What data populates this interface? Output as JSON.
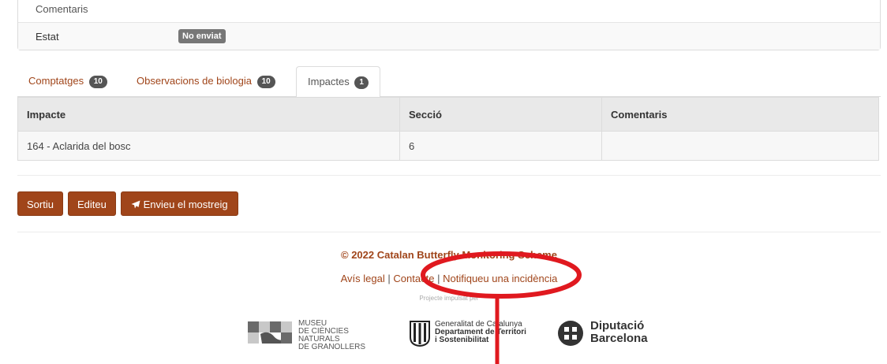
{
  "details": {
    "rows": [
      {
        "label": "Comentaris"
      },
      {
        "label": "Estat",
        "badge": "No enviat"
      }
    ]
  },
  "tabs": [
    {
      "label": "Comptatges",
      "count": "10",
      "active": false
    },
    {
      "label": "Observacions de biologia",
      "count": "10",
      "active": false
    },
    {
      "label": "Impactes",
      "count": "1",
      "active": true
    }
  ],
  "table": {
    "headers": [
      "Impacte",
      "Secció",
      "Comentaris"
    ],
    "rows": [
      [
        "164 - Aclarida del bosc",
        "6",
        ""
      ]
    ]
  },
  "actions": {
    "exit": "Sortiu",
    "edit": "Editeu",
    "send_icon": "paper-plane-icon",
    "send": "Envieu el mostreig"
  },
  "footer": {
    "copyright": "© 2022 Catalan Butterfly Monitoring Scheme",
    "links": [
      "Avís legal",
      "Contacte",
      "Notifiqueu una incidència"
    ],
    "separator": "|",
    "projecte": "Projecte impulsat per"
  },
  "logos": {
    "museu": [
      "MUSEU",
      "DE CIÈNCIES NATURALS",
      "DE GRANOLLERS"
    ],
    "generalitat": [
      "Generalitat de Catalunya",
      "Departament de Territori",
      "i Sostenibilitat"
    ],
    "diputacio": [
      "Diputació",
      "Barcelona"
    ]
  },
  "colors": {
    "accent": "#a0451a",
    "badge": "#555555",
    "annotation": "#e0191f"
  }
}
